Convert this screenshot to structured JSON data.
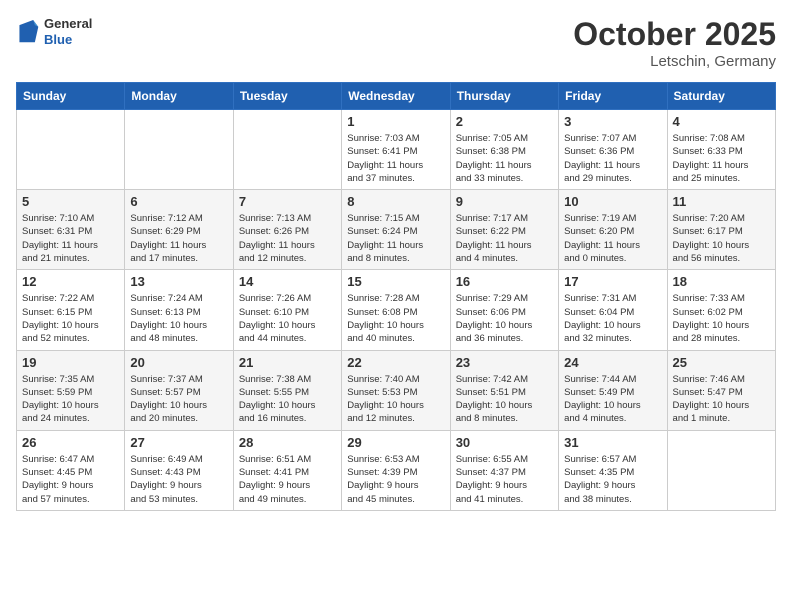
{
  "header": {
    "logo": {
      "general": "General",
      "blue": "Blue"
    },
    "month": "October 2025",
    "location": "Letschin, Germany"
  },
  "weekdays": [
    "Sunday",
    "Monday",
    "Tuesday",
    "Wednesday",
    "Thursday",
    "Friday",
    "Saturday"
  ],
  "weeks": [
    [
      {
        "day": "",
        "info": ""
      },
      {
        "day": "",
        "info": ""
      },
      {
        "day": "",
        "info": ""
      },
      {
        "day": "1",
        "info": "Sunrise: 7:03 AM\nSunset: 6:41 PM\nDaylight: 11 hours\nand 37 minutes."
      },
      {
        "day": "2",
        "info": "Sunrise: 7:05 AM\nSunset: 6:38 PM\nDaylight: 11 hours\nand 33 minutes."
      },
      {
        "day": "3",
        "info": "Sunrise: 7:07 AM\nSunset: 6:36 PM\nDaylight: 11 hours\nand 29 minutes."
      },
      {
        "day": "4",
        "info": "Sunrise: 7:08 AM\nSunset: 6:33 PM\nDaylight: 11 hours\nand 25 minutes."
      }
    ],
    [
      {
        "day": "5",
        "info": "Sunrise: 7:10 AM\nSunset: 6:31 PM\nDaylight: 11 hours\nand 21 minutes."
      },
      {
        "day": "6",
        "info": "Sunrise: 7:12 AM\nSunset: 6:29 PM\nDaylight: 11 hours\nand 17 minutes."
      },
      {
        "day": "7",
        "info": "Sunrise: 7:13 AM\nSunset: 6:26 PM\nDaylight: 11 hours\nand 12 minutes."
      },
      {
        "day": "8",
        "info": "Sunrise: 7:15 AM\nSunset: 6:24 PM\nDaylight: 11 hours\nand 8 minutes."
      },
      {
        "day": "9",
        "info": "Sunrise: 7:17 AM\nSunset: 6:22 PM\nDaylight: 11 hours\nand 4 minutes."
      },
      {
        "day": "10",
        "info": "Sunrise: 7:19 AM\nSunset: 6:20 PM\nDaylight: 11 hours\nand 0 minutes."
      },
      {
        "day": "11",
        "info": "Sunrise: 7:20 AM\nSunset: 6:17 PM\nDaylight: 10 hours\nand 56 minutes."
      }
    ],
    [
      {
        "day": "12",
        "info": "Sunrise: 7:22 AM\nSunset: 6:15 PM\nDaylight: 10 hours\nand 52 minutes."
      },
      {
        "day": "13",
        "info": "Sunrise: 7:24 AM\nSunset: 6:13 PM\nDaylight: 10 hours\nand 48 minutes."
      },
      {
        "day": "14",
        "info": "Sunrise: 7:26 AM\nSunset: 6:10 PM\nDaylight: 10 hours\nand 44 minutes."
      },
      {
        "day": "15",
        "info": "Sunrise: 7:28 AM\nSunset: 6:08 PM\nDaylight: 10 hours\nand 40 minutes."
      },
      {
        "day": "16",
        "info": "Sunrise: 7:29 AM\nSunset: 6:06 PM\nDaylight: 10 hours\nand 36 minutes."
      },
      {
        "day": "17",
        "info": "Sunrise: 7:31 AM\nSunset: 6:04 PM\nDaylight: 10 hours\nand 32 minutes."
      },
      {
        "day": "18",
        "info": "Sunrise: 7:33 AM\nSunset: 6:02 PM\nDaylight: 10 hours\nand 28 minutes."
      }
    ],
    [
      {
        "day": "19",
        "info": "Sunrise: 7:35 AM\nSunset: 5:59 PM\nDaylight: 10 hours\nand 24 minutes."
      },
      {
        "day": "20",
        "info": "Sunrise: 7:37 AM\nSunset: 5:57 PM\nDaylight: 10 hours\nand 20 minutes."
      },
      {
        "day": "21",
        "info": "Sunrise: 7:38 AM\nSunset: 5:55 PM\nDaylight: 10 hours\nand 16 minutes."
      },
      {
        "day": "22",
        "info": "Sunrise: 7:40 AM\nSunset: 5:53 PM\nDaylight: 10 hours\nand 12 minutes."
      },
      {
        "day": "23",
        "info": "Sunrise: 7:42 AM\nSunset: 5:51 PM\nDaylight: 10 hours\nand 8 minutes."
      },
      {
        "day": "24",
        "info": "Sunrise: 7:44 AM\nSunset: 5:49 PM\nDaylight: 10 hours\nand 4 minutes."
      },
      {
        "day": "25",
        "info": "Sunrise: 7:46 AM\nSunset: 5:47 PM\nDaylight: 10 hours\nand 1 minute."
      }
    ],
    [
      {
        "day": "26",
        "info": "Sunrise: 6:47 AM\nSunset: 4:45 PM\nDaylight: 9 hours\nand 57 minutes."
      },
      {
        "day": "27",
        "info": "Sunrise: 6:49 AM\nSunset: 4:43 PM\nDaylight: 9 hours\nand 53 minutes."
      },
      {
        "day": "28",
        "info": "Sunrise: 6:51 AM\nSunset: 4:41 PM\nDaylight: 9 hours\nand 49 minutes."
      },
      {
        "day": "29",
        "info": "Sunrise: 6:53 AM\nSunset: 4:39 PM\nDaylight: 9 hours\nand 45 minutes."
      },
      {
        "day": "30",
        "info": "Sunrise: 6:55 AM\nSunset: 4:37 PM\nDaylight: 9 hours\nand 41 minutes."
      },
      {
        "day": "31",
        "info": "Sunrise: 6:57 AM\nSunset: 4:35 PM\nDaylight: 9 hours\nand 38 minutes."
      },
      {
        "day": "",
        "info": ""
      }
    ]
  ]
}
